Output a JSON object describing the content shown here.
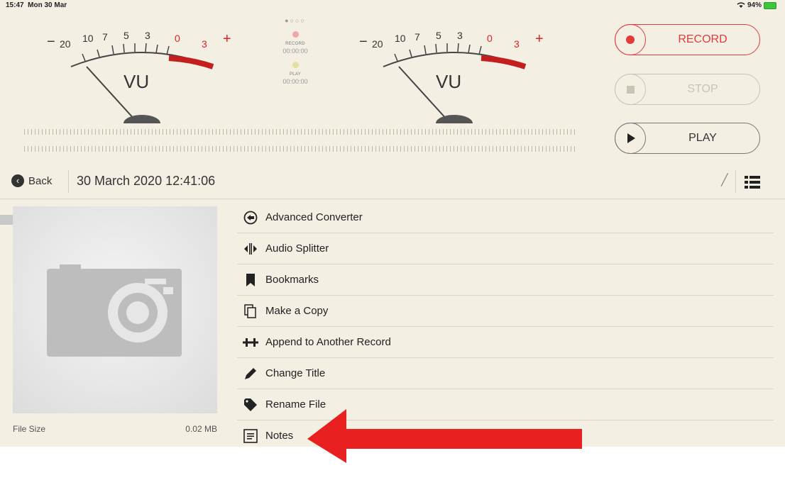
{
  "status_bar": {
    "time": "15:47",
    "date": "Mon 30 Mar",
    "wifi_icon": "wifi-icon",
    "battery": "94%"
  },
  "meters": [
    {
      "scale": [
        "20",
        "10",
        "7",
        "5",
        "3",
        "0",
        "3"
      ],
      "minus": "−",
      "plus": "+",
      "label": "VU"
    },
    {
      "scale": [
        "20",
        "10",
        "7",
        "5",
        "3",
        "0",
        "3"
      ],
      "minus": "−",
      "plus": "+",
      "label": "VU"
    }
  ],
  "center_panel": {
    "page_dots": "●○○○",
    "record_label": "RECORD",
    "record_time": "00:00:00",
    "play_label": "PLAY",
    "play_time": "00:00:00",
    "record_led_color": "#f2a6a6",
    "play_led_color": "#e6e0a0"
  },
  "controls": {
    "record": "RECORD",
    "stop": "STOP",
    "play": "PLAY"
  },
  "colors": {
    "accent_red": "#e23b3b",
    "background": "#f4efe3",
    "arrow_red": "#e8201f"
  },
  "nav": {
    "back_label": "Back",
    "title": "30 March 2020 12:41:06"
  },
  "file_info": {
    "size_label": "File Size",
    "size_value": "0.02 MB"
  },
  "menu_items": [
    {
      "label": "Advanced Converter",
      "icon": "converter-icon"
    },
    {
      "label": "Audio Splitter",
      "icon": "splitter-icon"
    },
    {
      "label": "Bookmarks",
      "icon": "bookmark-icon"
    },
    {
      "label": "Make a Copy",
      "icon": "copy-icon"
    },
    {
      "label": "Append to Another Record",
      "icon": "append-icon"
    },
    {
      "label": "Change Title",
      "icon": "pencil-icon"
    },
    {
      "label": "Rename File",
      "icon": "tag-icon"
    },
    {
      "label": "Notes",
      "icon": "notes-icon"
    }
  ]
}
